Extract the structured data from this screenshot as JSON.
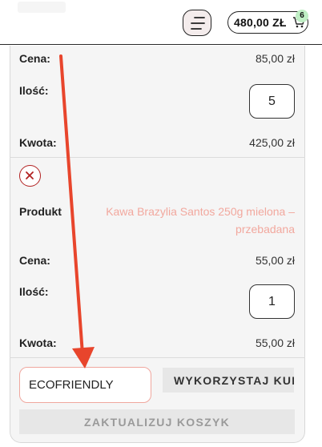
{
  "header": {
    "cart_total": "480,00 ZŁ",
    "cart_count": "6",
    "menu_icon": "hamburger-menu-icon",
    "cart_icon": "shopping-cart-icon"
  },
  "item1": {
    "price_label": "Cena:",
    "price_value": "85,00 zł",
    "qty_label": "Ilość:",
    "qty_value": "5",
    "amount_label": "Kwota:",
    "amount_value": "425,00 zł"
  },
  "item2": {
    "remove_icon": "close-icon",
    "product_label": "Produkt",
    "product_name": "Kawa Brazylia Santos 250g mielona – przebadana",
    "price_label": "Cena:",
    "price_value": "55,00 zł",
    "qty_label": "Ilość:",
    "qty_value": "1",
    "amount_label": "Kwota:",
    "amount_value": "55,00 zł"
  },
  "coupon": {
    "code_value": "ECOFRIENDLY",
    "apply_label": "WYKORZYSTAJ KUPON"
  },
  "update_label": "ZAKTUALIZUJ KOSZYK",
  "colors": {
    "accent_arrow": "#e8452c",
    "product_link": "#f2a89e",
    "remove_red": "#b22222",
    "badge": "#bfeec4"
  }
}
